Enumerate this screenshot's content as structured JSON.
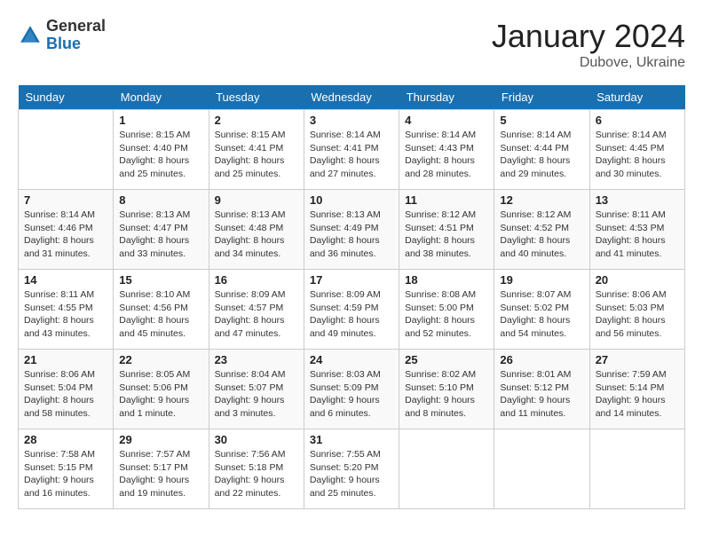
{
  "logo": {
    "general": "General",
    "blue": "Blue"
  },
  "header": {
    "month_year": "January 2024",
    "location": "Dubove, Ukraine"
  },
  "weekdays": [
    "Sunday",
    "Monday",
    "Tuesday",
    "Wednesday",
    "Thursday",
    "Friday",
    "Saturday"
  ],
  "weeks": [
    [
      {
        "day": "",
        "info": ""
      },
      {
        "day": "1",
        "info": "Sunrise: 8:15 AM\nSunset: 4:40 PM\nDaylight: 8 hours\nand 25 minutes."
      },
      {
        "day": "2",
        "info": "Sunrise: 8:15 AM\nSunset: 4:41 PM\nDaylight: 8 hours\nand 25 minutes."
      },
      {
        "day": "3",
        "info": "Sunrise: 8:14 AM\nSunset: 4:41 PM\nDaylight: 8 hours\nand 27 minutes."
      },
      {
        "day": "4",
        "info": "Sunrise: 8:14 AM\nSunset: 4:43 PM\nDaylight: 8 hours\nand 28 minutes."
      },
      {
        "day": "5",
        "info": "Sunrise: 8:14 AM\nSunset: 4:44 PM\nDaylight: 8 hours\nand 29 minutes."
      },
      {
        "day": "6",
        "info": "Sunrise: 8:14 AM\nSunset: 4:45 PM\nDaylight: 8 hours\nand 30 minutes."
      }
    ],
    [
      {
        "day": "7",
        "info": "Sunrise: 8:14 AM\nSunset: 4:46 PM\nDaylight: 8 hours\nand 31 minutes."
      },
      {
        "day": "8",
        "info": "Sunrise: 8:13 AM\nSunset: 4:47 PM\nDaylight: 8 hours\nand 33 minutes."
      },
      {
        "day": "9",
        "info": "Sunrise: 8:13 AM\nSunset: 4:48 PM\nDaylight: 8 hours\nand 34 minutes."
      },
      {
        "day": "10",
        "info": "Sunrise: 8:13 AM\nSunset: 4:49 PM\nDaylight: 8 hours\nand 36 minutes."
      },
      {
        "day": "11",
        "info": "Sunrise: 8:12 AM\nSunset: 4:51 PM\nDaylight: 8 hours\nand 38 minutes."
      },
      {
        "day": "12",
        "info": "Sunrise: 8:12 AM\nSunset: 4:52 PM\nDaylight: 8 hours\nand 40 minutes."
      },
      {
        "day": "13",
        "info": "Sunrise: 8:11 AM\nSunset: 4:53 PM\nDaylight: 8 hours\nand 41 minutes."
      }
    ],
    [
      {
        "day": "14",
        "info": "Sunrise: 8:11 AM\nSunset: 4:55 PM\nDaylight: 8 hours\nand 43 minutes."
      },
      {
        "day": "15",
        "info": "Sunrise: 8:10 AM\nSunset: 4:56 PM\nDaylight: 8 hours\nand 45 minutes."
      },
      {
        "day": "16",
        "info": "Sunrise: 8:09 AM\nSunset: 4:57 PM\nDaylight: 8 hours\nand 47 minutes."
      },
      {
        "day": "17",
        "info": "Sunrise: 8:09 AM\nSunset: 4:59 PM\nDaylight: 8 hours\nand 49 minutes."
      },
      {
        "day": "18",
        "info": "Sunrise: 8:08 AM\nSunset: 5:00 PM\nDaylight: 8 hours\nand 52 minutes."
      },
      {
        "day": "19",
        "info": "Sunrise: 8:07 AM\nSunset: 5:02 PM\nDaylight: 8 hours\nand 54 minutes."
      },
      {
        "day": "20",
        "info": "Sunrise: 8:06 AM\nSunset: 5:03 PM\nDaylight: 8 hours\nand 56 minutes."
      }
    ],
    [
      {
        "day": "21",
        "info": "Sunrise: 8:06 AM\nSunset: 5:04 PM\nDaylight: 8 hours\nand 58 minutes."
      },
      {
        "day": "22",
        "info": "Sunrise: 8:05 AM\nSunset: 5:06 PM\nDaylight: 9 hours\nand 1 minute."
      },
      {
        "day": "23",
        "info": "Sunrise: 8:04 AM\nSunset: 5:07 PM\nDaylight: 9 hours\nand 3 minutes."
      },
      {
        "day": "24",
        "info": "Sunrise: 8:03 AM\nSunset: 5:09 PM\nDaylight: 9 hours\nand 6 minutes."
      },
      {
        "day": "25",
        "info": "Sunrise: 8:02 AM\nSunset: 5:10 PM\nDaylight: 9 hours\nand 8 minutes."
      },
      {
        "day": "26",
        "info": "Sunrise: 8:01 AM\nSunset: 5:12 PM\nDaylight: 9 hours\nand 11 minutes."
      },
      {
        "day": "27",
        "info": "Sunrise: 7:59 AM\nSunset: 5:14 PM\nDaylight: 9 hours\nand 14 minutes."
      }
    ],
    [
      {
        "day": "28",
        "info": "Sunrise: 7:58 AM\nSunset: 5:15 PM\nDaylight: 9 hours\nand 16 minutes."
      },
      {
        "day": "29",
        "info": "Sunrise: 7:57 AM\nSunset: 5:17 PM\nDaylight: 9 hours\nand 19 minutes."
      },
      {
        "day": "30",
        "info": "Sunrise: 7:56 AM\nSunset: 5:18 PM\nDaylight: 9 hours\nand 22 minutes."
      },
      {
        "day": "31",
        "info": "Sunrise: 7:55 AM\nSunset: 5:20 PM\nDaylight: 9 hours\nand 25 minutes."
      },
      {
        "day": "",
        "info": ""
      },
      {
        "day": "",
        "info": ""
      },
      {
        "day": "",
        "info": ""
      }
    ]
  ]
}
